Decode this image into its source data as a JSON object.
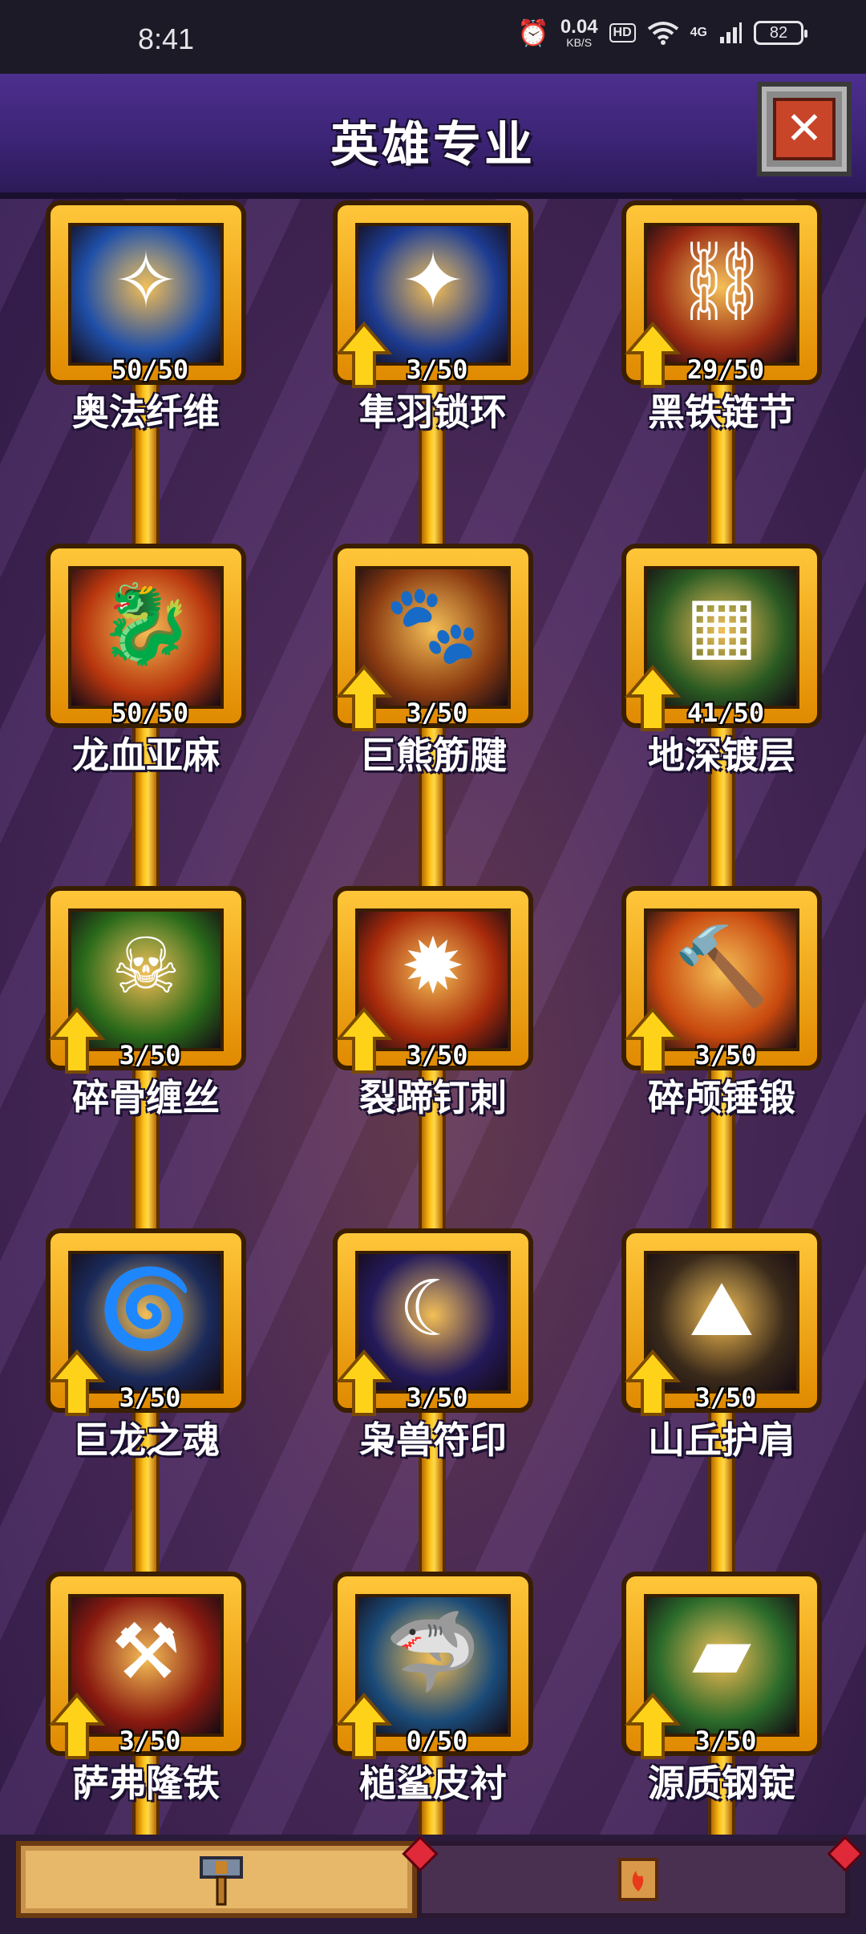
{
  "status_bar": {
    "time": "8:41",
    "speed_value": "0.04",
    "speed_unit": "KB/S",
    "hd": "HD",
    "network": "4G",
    "battery": "82"
  },
  "header": {
    "title": "英雄专业"
  },
  "skills": [
    {
      "name": "奥法纤维",
      "level": "50/50",
      "upgradable": false,
      "icon": "feather-lightning-icon",
      "bg": "#1f4fa8"
    },
    {
      "name": "隼羽锁环",
      "level": "3/50",
      "upgradable": true,
      "icon": "feather-icon",
      "bg": "#1d3c92"
    },
    {
      "name": "黑铁链节",
      "level": "29/50",
      "upgradable": true,
      "icon": "chain-icon",
      "bg": "#9a2a12"
    },
    {
      "name": "龙血亚麻",
      "level": "50/50",
      "upgradable": false,
      "icon": "dragon-icon",
      "bg": "#b8360e"
    },
    {
      "name": "巨熊筋腱",
      "level": "3/50",
      "upgradable": true,
      "icon": "paw-icon",
      "bg": "#8a3a10"
    },
    {
      "name": "地深镀层",
      "level": "41/50",
      "upgradable": true,
      "icon": "stone-icon",
      "bg": "#2a5a22"
    },
    {
      "name": "碎骨缠丝",
      "level": "3/50",
      "upgradable": true,
      "icon": "skull-icon",
      "bg": "#2a6a1a"
    },
    {
      "name": "裂蹄钉刺",
      "level": "3/50",
      "upgradable": true,
      "icon": "spikes-icon",
      "bg": "#a82a0a"
    },
    {
      "name": "碎颅锤锻",
      "level": "3/50",
      "upgradable": true,
      "icon": "hammer-icon",
      "bg": "#c8480e"
    },
    {
      "name": "巨龙之魂",
      "level": "3/50",
      "upgradable": true,
      "icon": "serpent-icon",
      "bg": "#1a2a5a"
    },
    {
      "name": "枭兽符印",
      "level": "3/50",
      "upgradable": true,
      "icon": "owl-moon-icon",
      "bg": "#241a5a"
    },
    {
      "name": "山丘护肩",
      "level": "3/50",
      "upgradable": true,
      "icon": "pauldron-icon",
      "bg": "#3a2a1a"
    },
    {
      "name": "萨弗隆铁",
      "level": "3/50",
      "upgradable": true,
      "icon": "anvil-icon",
      "bg": "#8a1a10"
    },
    {
      "name": "槌鲨皮衬",
      "level": "0/50",
      "upgradable": true,
      "icon": "shark-fin-icon",
      "bg": "#1a4a78"
    },
    {
      "name": "源质钢锭",
      "level": "3/50",
      "upgradable": true,
      "icon": "ingot-icon",
      "bg": "#2a6a2a"
    }
  ],
  "bottom_tabs": [
    {
      "icon": "hammer-tab-icon",
      "active": true
    },
    {
      "icon": "scroll-tab-icon",
      "active": false
    }
  ]
}
